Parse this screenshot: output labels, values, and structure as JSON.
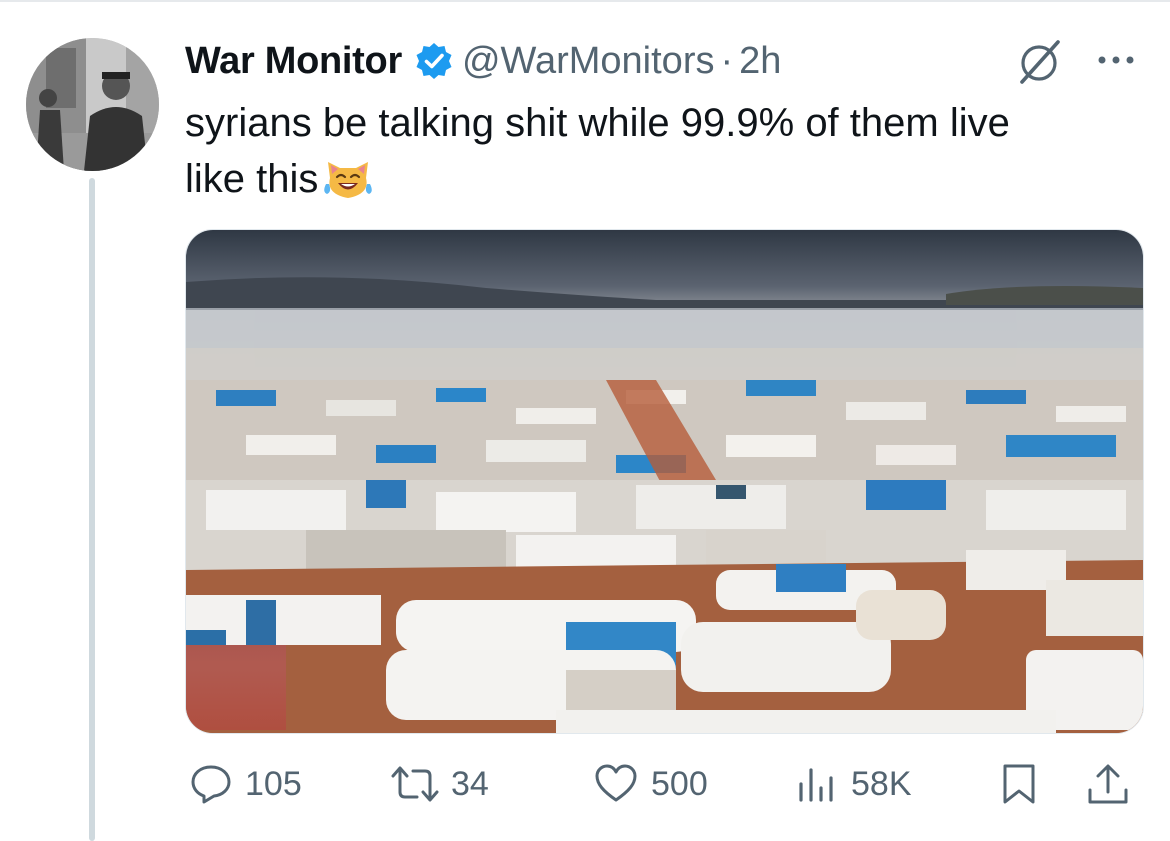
{
  "tweet": {
    "author_name": "War Monitor",
    "author_handle": "@WarMonitors",
    "separator": "·",
    "time": "2h",
    "text": "syrians be talking shit while 99.9% of them live\nlike this",
    "emoji": "😹",
    "verified": true
  },
  "icons": {
    "verified": "verified-badge-icon",
    "grok": "grok-icon",
    "more": "more-icon",
    "reply": "reply-icon",
    "retweet": "retweet-icon",
    "like": "like-icon",
    "views": "views-icon",
    "bookmark": "bookmark-icon",
    "share": "share-icon"
  },
  "stats": {
    "replies": "105",
    "retweets": "34",
    "likes": "500",
    "views": "58K"
  },
  "colors": {
    "verified_blue": "#1d9bf0",
    "secondary_text": "#536471",
    "thread_line": "#cfd9de"
  }
}
